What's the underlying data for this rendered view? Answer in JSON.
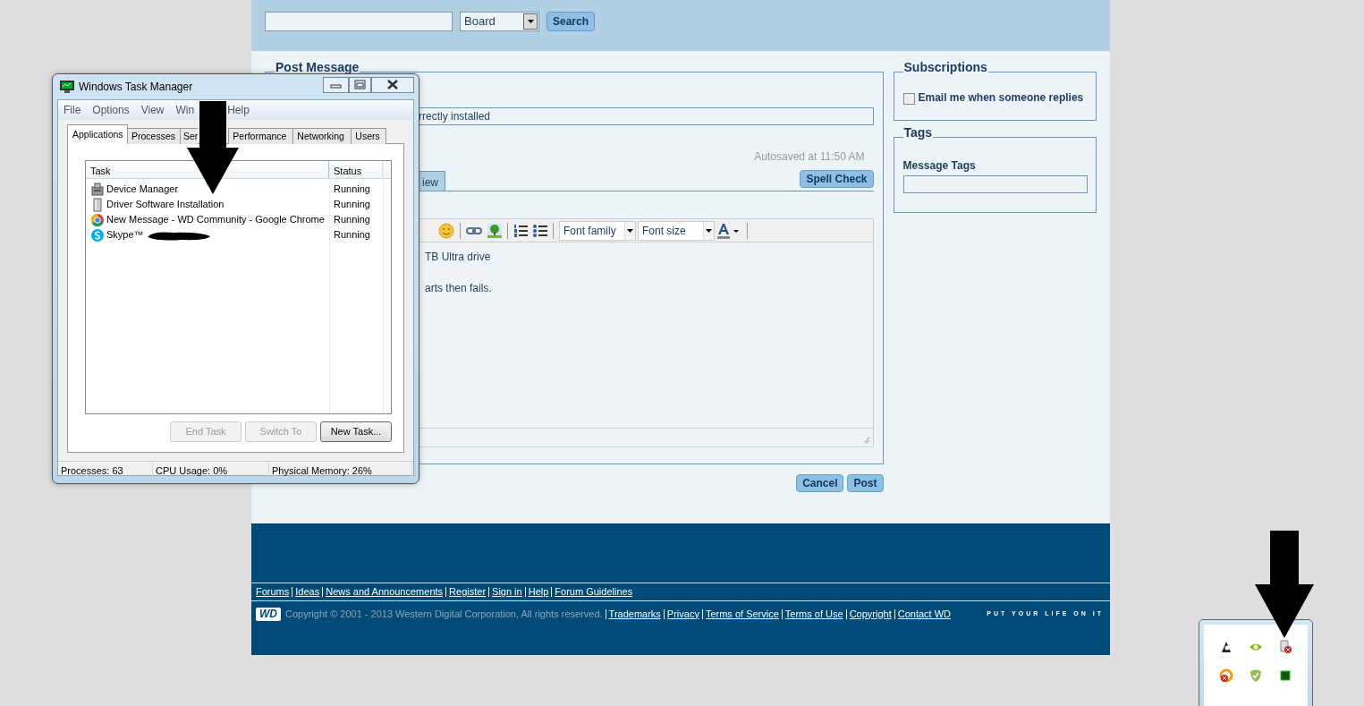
{
  "search": {
    "scope": "Board",
    "button": "Search"
  },
  "post": {
    "legend": "Post Message",
    "subject": "rrectly installed",
    "autosave": "Autosaved at 11:50 AM",
    "tab": "iew",
    "spell_check": "Spell Check",
    "font_family": "Font family",
    "font_size": "Font size",
    "body": [
      "TB Ultra drive",
      "arts then fails."
    ],
    "buttons": [
      "Cancel",
      "Post"
    ]
  },
  "subscriptions": {
    "legend": "Subscriptions",
    "option": {
      "label": "Email me when someone replies",
      "checked": false
    }
  },
  "tags": {
    "legend": "Tags",
    "label": "Message Tags"
  },
  "footer": {
    "links": [
      "Forums",
      "Ideas",
      "News and Announcements",
      "Register",
      "Sign in",
      "Help",
      "Forum Guidelines"
    ],
    "logo": "WD",
    "copyright": "Copyright © 2001 - 2013 Western Digital Corporation, All rights reserved.",
    "legal_links": [
      "Trademarks",
      "Privacy",
      "Terms of Service",
      "Terms of Use",
      "Copyright",
      "Contact WD"
    ],
    "tagline": "PUT YOUR LIFE ON IT"
  },
  "task_manager": {
    "title": "Windows Task Manager",
    "menu": [
      "File",
      "Options",
      "View",
      "Win",
      "Help"
    ],
    "tabs": [
      {
        "label": "Applications",
        "selected": true
      },
      {
        "label": "Processes",
        "selected": false
      },
      {
        "label": "Ser",
        "selected": false
      },
      {
        "label": "Performance",
        "selected": false
      },
      {
        "label": "Networking",
        "selected": false
      },
      {
        "label": "Users",
        "selected": false
      }
    ],
    "columns": [
      "Task",
      "Status"
    ],
    "rows": [
      {
        "task": "Device Manager",
        "status": "Running",
        "kind": "device",
        "redacted": false
      },
      {
        "task": "Driver Software Installation",
        "status": "Running",
        "kind": "installer",
        "redacted": false
      },
      {
        "task": "New Message - WD Community - Google Chrome",
        "status": "Running",
        "kind": "browser",
        "redacted": false
      },
      {
        "task": "Skype™",
        "status": "Running",
        "kind": "chat",
        "redacted": true
      }
    ],
    "buttons": [
      {
        "label": "End Task",
        "disabled": true
      },
      {
        "label": "Switch To",
        "disabled": true
      },
      {
        "label": "New Task...",
        "disabled": false
      }
    ],
    "status_bar": [
      "Processes: 63",
      "CPU Usage: 0%",
      "Physical Memory: 26%"
    ]
  }
}
